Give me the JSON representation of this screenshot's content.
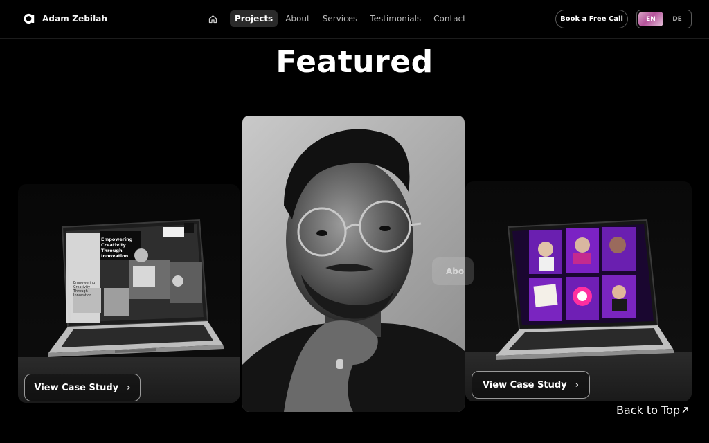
{
  "brand": {
    "name": "Adam Zebilah",
    "logo_letter": "a"
  },
  "nav": {
    "home_icon": "home-icon",
    "items": [
      {
        "label": "Projects",
        "active": true
      },
      {
        "label": "About",
        "active": false
      },
      {
        "label": "Services",
        "active": false
      },
      {
        "label": "Testimonials",
        "active": false
      },
      {
        "label": "Contact",
        "active": false
      }
    ],
    "cta_label": "Book a Free Call",
    "languages": [
      {
        "label": "EN",
        "active": true
      },
      {
        "label": "DE",
        "active": false
      }
    ]
  },
  "main": {
    "heading": "Featured",
    "left_card": {
      "button_label": "View Case Study",
      "screen_text": [
        "Empowering",
        "Creativity",
        "Through",
        "Innovation"
      ],
      "screen_text_small": [
        "Empowering",
        "Creativity",
        "Through",
        "Innovation"
      ]
    },
    "right_card": {
      "button_label": "View Case Study"
    },
    "peek_label": "Abo",
    "back_to_top": "Back to Top"
  },
  "colors": {
    "background": "#000000",
    "accent_pink": "#b4529a",
    "purple": "#6a1fb0"
  }
}
